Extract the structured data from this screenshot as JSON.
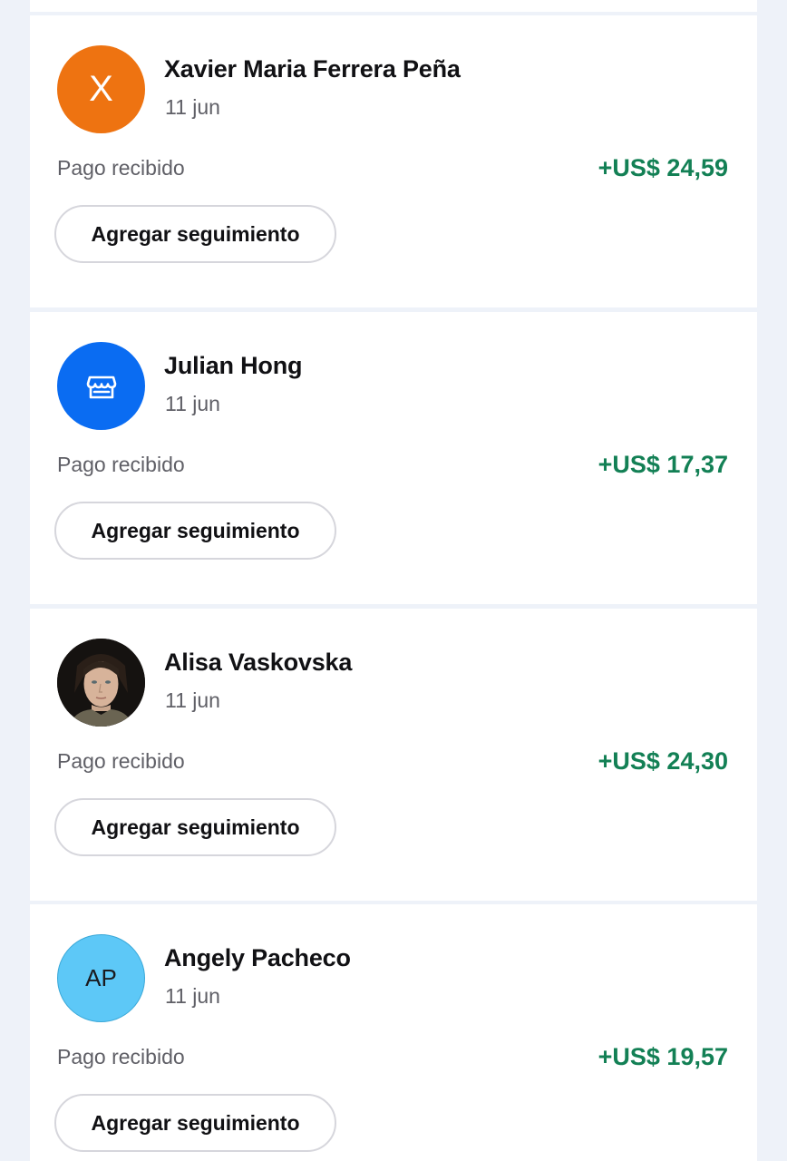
{
  "colors": {
    "page_background": "#eef2f9",
    "card_background": "#ffffff",
    "amount_green": "#138055",
    "secondary_text": "#5f5f66"
  },
  "transactions": [
    {
      "name": "Xavier Maria Ferrera Peña",
      "date": "11 jun",
      "status": "Pago recibido",
      "amount": "+US$ 24,59",
      "button_label": "Agregar seguimiento",
      "avatar": {
        "type": "initial",
        "text": "X",
        "color": "#ee7311"
      }
    },
    {
      "name": "Julian Hong",
      "date": "11 jun",
      "status": "Pago recibido",
      "amount": "+US$ 17,37",
      "button_label": "Agregar seguimiento",
      "avatar": {
        "type": "icon",
        "icon": "storefront-icon",
        "color": "#0a6cf2"
      }
    },
    {
      "name": "Alisa Vaskovska",
      "date": "11 jun",
      "status": "Pago recibido",
      "amount": "+US$ 24,30",
      "button_label": "Agregar seguimiento",
      "avatar": {
        "type": "photo",
        "icon": "profile-photo"
      }
    },
    {
      "name": "Angely Pacheco",
      "date": "11 jun",
      "status": "Pago recibido",
      "amount": "+US$ 19,57",
      "button_label": "Agregar seguimiento",
      "avatar": {
        "type": "initials",
        "text": "AP",
        "color": "#5dc8f7"
      }
    }
  ]
}
